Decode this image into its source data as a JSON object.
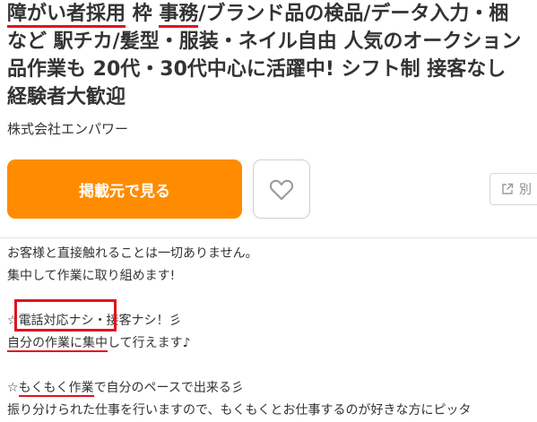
{
  "job": {
    "title_lines": [
      [
        "障がい者採用",
        " 枠 ",
        "事務",
        "/ブランド品の検品/データ入力・梱"
      ],
      "など 駅チカ/髪型・服装・ネイル自由 人気のオークション",
      "品作業も 20代・30代中心に活躍中! シフト制 接客なし",
      "経験者大歓迎"
    ],
    "company": "株式会社エンパワー"
  },
  "actions": {
    "apply_label": "掲載元で見る",
    "favorite_icon": "heart-icon",
    "other_label": "別",
    "other_icon": "external-link-icon"
  },
  "description": {
    "lines": [
      "お客様と直接触れることは一切ありません。",
      "集中して作業に取り組めます!",
      "",
      [
        "☆",
        "電話対応ナシ",
        "・接客ナシ！彡"
      ],
      [
        "自分の",
        "作業",
        "に",
        "集中",
        "して行えます♪"
      ],
      "",
      [
        "☆",
        "もくもく作業",
        "で自分のペースで出来る彡"
      ],
      "振り分けられた仕事を行いますので、もくもくとお仕事するのが好きな方にピッタ"
    ]
  },
  "colors": {
    "accent": "#ff8c00",
    "highlight_red": "#e0141e",
    "text": "#333333"
  }
}
